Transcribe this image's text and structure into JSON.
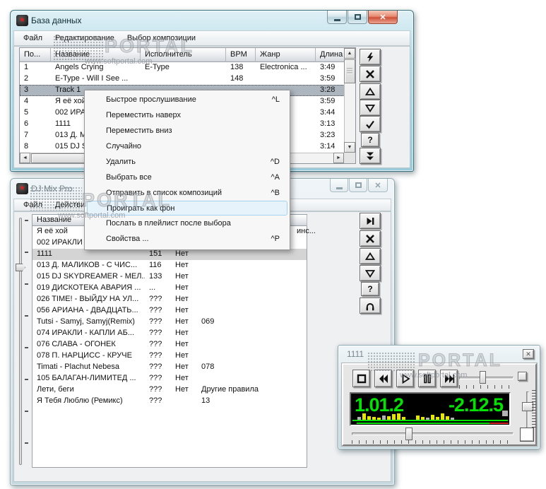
{
  "watermark": {
    "brand": "PORTAL",
    "site": "www.softportal.com"
  },
  "colors": {
    "lcd_green": "#00e400",
    "lcd_red": "#d42020",
    "bar_yellow": "#e6e600",
    "bar_gray": "#b2b2b2",
    "close_red": "#cf5038",
    "frame_teal": "#9bcbda"
  },
  "db_window": {
    "title": "База данных",
    "menu": [
      "Файл",
      "Редактирование",
      "Выбор композиции"
    ],
    "columns": [
      "По...",
      "Название",
      "Исполнитель",
      "BPM",
      "Жанр",
      "Длина"
    ],
    "rows": [
      {
        "pos": "1",
        "name": "Angels Crying",
        "artist": "E-Type",
        "bpm": "138",
        "genre": "Electronica ...",
        "dur": "3:49",
        "selected": false
      },
      {
        "pos": "2",
        "name": "E-Type - Will I See ...",
        "artist": "",
        "bpm": "148",
        "genre": "",
        "dur": "3:59",
        "selected": false
      },
      {
        "pos": "3",
        "name": "Track 1",
        "artist": "",
        "bpm": "",
        "genre": "",
        "dur": "3:28",
        "selected": true
      },
      {
        "pos": "4",
        "name": "Я её хой",
        "artist": "",
        "bpm": "",
        "genre": "",
        "dur": "3:59",
        "selected": false
      },
      {
        "pos": "5",
        "name": "002 ИРАКЛИ",
        "artist": "",
        "bpm": "",
        "genre": "",
        "dur": "3:44",
        "selected": false
      },
      {
        "pos": "6",
        "name": "1111",
        "artist": "",
        "bpm": "",
        "genre": "",
        "dur": "3:13",
        "selected": false
      },
      {
        "pos": "7",
        "name": "013 Д. МАЛИКОВ",
        "artist": "",
        "bpm": "",
        "genre": "",
        "dur": "3:23",
        "selected": false
      },
      {
        "pos": "8",
        "name": "015 DJ SKYDREAMER",
        "artist": "",
        "bpm": "",
        "genre": "",
        "dur": "3:14",
        "selected": false
      }
    ],
    "toolbar": [
      {
        "icon": "lightning"
      },
      {
        "icon": "close-x"
      },
      {
        "icon": "tri-up"
      },
      {
        "icon": "tri-down"
      },
      {
        "icon": "check"
      },
      {
        "icon": "help"
      },
      {
        "icon": "dbl-down"
      }
    ]
  },
  "context_menu": {
    "items": [
      {
        "label": "Быстрое прослушивание",
        "shortcut": "^L",
        "highlighted": false
      },
      {
        "label": "Переместить наверх",
        "shortcut": "",
        "highlighted": false
      },
      {
        "label": "Переместить вниз",
        "shortcut": "",
        "highlighted": false
      },
      {
        "label": "Случайно",
        "shortcut": "",
        "highlighted": false
      },
      {
        "label": "Удалить",
        "shortcut": "^D",
        "highlighted": false
      },
      {
        "label": "Выбрать все",
        "shortcut": "^A",
        "highlighted": false
      },
      {
        "label": "Отправить в список композиций",
        "shortcut": "^B",
        "highlighted": false
      },
      {
        "label": "Проиграть как фон",
        "shortcut": "",
        "highlighted": true
      },
      {
        "label": "Послать в плейлист после выбора",
        "shortcut": "",
        "highlighted": false
      },
      {
        "label": "Свойства ...",
        "shortcut": "^P",
        "highlighted": false
      }
    ]
  },
  "mix_window": {
    "title": "DJ Mix Pro",
    "menu": [
      "Файл",
      "Действия"
    ],
    "columns": [
      "Название",
      "",
      "",
      ""
    ],
    "rows": [
      {
        "name": "Я её хой",
        "bpm": "",
        "net": "",
        "extra": "",
        "tail": "инс...",
        "selected": false
      },
      {
        "name": "002 ИРАКЛИ",
        "bpm": "",
        "net": "",
        "extra": "",
        "selected": false
      },
      {
        "name": "1111",
        "bpm": "151",
        "net": "Нет",
        "extra": "",
        "selected": true
      },
      {
        "name": "013 Д. МАЛИКОВ - С ЧИС...",
        "bpm": "116",
        "net": "Нет",
        "extra": "",
        "selected": false
      },
      {
        "name": "015 DJ SKYDREAMER - МЕЛ...",
        "bpm": "133",
        "net": "Нет",
        "extra": "",
        "selected": false
      },
      {
        "name": "019 ДИСКОТЕКА АВАРИЯ ...",
        "bpm": "...",
        "net": "Нет",
        "extra": "",
        "selected": false
      },
      {
        "name": "026 TIME! - ВЫЙДУ НА УЛ...",
        "bpm": "???",
        "net": "Нет",
        "extra": "",
        "selected": false
      },
      {
        "name": "056 АРИАНА - ДВАДЦАТЬ...",
        "bpm": "???",
        "net": "Нет",
        "extra": "",
        "selected": false
      },
      {
        "name": "Tutsi - Samyj, Samyj(Remix)",
        "bpm": "???",
        "net": "Нет",
        "extra": "069",
        "selected": false
      },
      {
        "name": "074 ИРАКЛИ - КАПЛИ АБ...",
        "bpm": "???",
        "net": "Нет",
        "extra": "",
        "selected": false
      },
      {
        "name": "076 СЛАВА - ОГОНЕК",
        "bpm": "???",
        "net": "Нет",
        "extra": "",
        "selected": false
      },
      {
        "name": "078 П. НАРЦИСС - КРУЧЕ",
        "bpm": "???",
        "net": "Нет",
        "extra": "",
        "selected": false
      },
      {
        "name": "Timati - Plachut Nebesa",
        "bpm": "???",
        "net": "Нет",
        "extra": "078",
        "selected": false
      },
      {
        "name": "105 БАЛАГАН-ЛИМИТЕД ...",
        "bpm": "???",
        "net": "Нет",
        "extra": "",
        "selected": false
      },
      {
        "name": "Лети, беги",
        "bpm": "???",
        "net": "Нет",
        "extra": "Другие правила",
        "selected": false
      },
      {
        "name": "Я Тебя Люблю (Ремикс)",
        "bpm": "???",
        "net": "",
        "extra": "13",
        "selected": false
      }
    ],
    "toolbar": [
      {
        "icon": "skip-end"
      },
      {
        "icon": "close-x"
      },
      {
        "icon": "tri-up"
      },
      {
        "icon": "tri-down"
      },
      {
        "icon": "help"
      },
      {
        "icon": "headphones"
      }
    ]
  },
  "player": {
    "title": "1111",
    "time_elapsed": "1.01.2",
    "time_remaining": "-2.12.5",
    "controls": [
      {
        "icon": "stop"
      },
      {
        "icon": "rew"
      },
      {
        "icon": "play"
      },
      {
        "icon": "pause"
      },
      {
        "icon": "ff"
      }
    ],
    "spectrum_a": [
      {
        "h": 4,
        "c": "g"
      },
      {
        "h": 9,
        "c": "y"
      },
      {
        "h": 5,
        "c": "y"
      },
      {
        "h": 4,
        "c": "y"
      },
      {
        "h": 3,
        "c": "y"
      },
      {
        "h": 6,
        "c": "g"
      },
      {
        "h": 5,
        "c": "y"
      },
      {
        "h": 8,
        "c": "y"
      },
      {
        "h": 9,
        "c": "y"
      },
      {
        "h": 4,
        "c": "y"
      }
    ],
    "spectrum_b": [
      {
        "h": 6,
        "c": "y"
      },
      {
        "h": 4,
        "c": "y"
      },
      {
        "h": 3,
        "c": "g"
      },
      {
        "h": 7,
        "c": "y"
      },
      {
        "h": 4,
        "c": "y"
      },
      {
        "h": 9,
        "c": "y"
      },
      {
        "h": 5,
        "c": "y"
      },
      {
        "h": 3,
        "c": "g"
      }
    ]
  }
}
